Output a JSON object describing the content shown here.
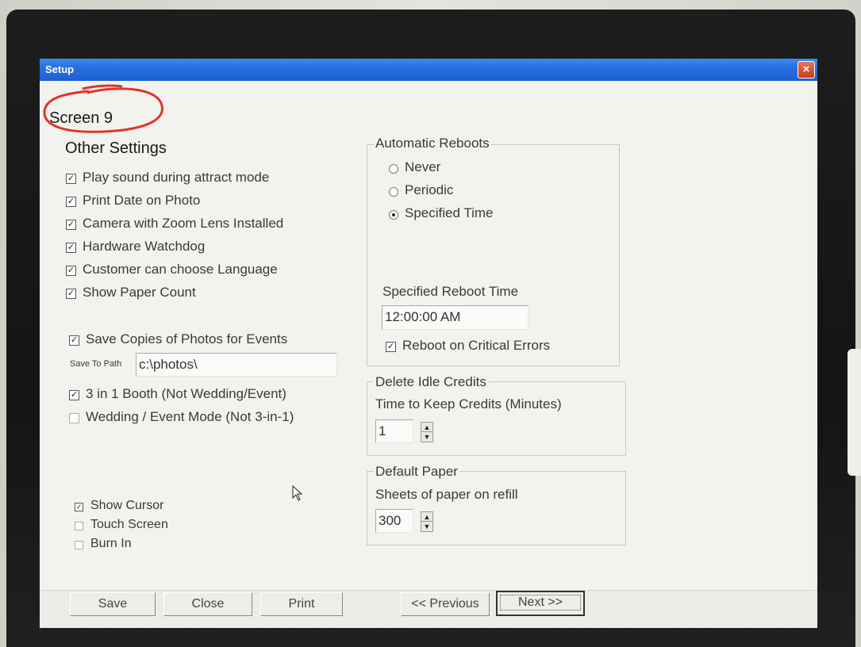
{
  "window": {
    "title": "Setup",
    "close_glyph": "×"
  },
  "screen_label": "Screen 9",
  "section_title": "Other Settings",
  "other_settings": [
    {
      "label": "Play sound during attract mode",
      "checked": true
    },
    {
      "label": "Print Date on Photo",
      "checked": true
    },
    {
      "label": "Camera with Zoom Lens Installed",
      "checked": true
    },
    {
      "label": "Hardware Watchdog",
      "checked": true
    },
    {
      "label": "Customer can choose Language",
      "checked": true
    },
    {
      "label": "Show Paper Count",
      "checked": true
    }
  ],
  "save_copies": {
    "label": "Save Copies of Photos for Events",
    "checked": true
  },
  "save_path": {
    "label": "Save To Path",
    "value": "c:\\photos\\"
  },
  "booth_modes": [
    {
      "label": "3 in 1 Booth (Not Wedding/Event)",
      "checked": true
    },
    {
      "label": "Wedding / Event Mode  (Not 3-in-1)",
      "checked": false
    }
  ],
  "display_options": [
    {
      "label": "Show Cursor",
      "checked": true
    },
    {
      "label": "Touch Screen",
      "checked": false
    },
    {
      "label": "Burn In",
      "checked": false
    }
  ],
  "reboots": {
    "title": "Automatic Reboots",
    "options": [
      {
        "label": "Never",
        "selected": false
      },
      {
        "label": "Periodic",
        "selected": false
      },
      {
        "label": "Specified Time",
        "selected": true
      }
    ],
    "time_label": "Specified Reboot Time",
    "time_value": "12:00:00 AM",
    "critical_label": "Reboot on Critical Errors",
    "critical_checked": true
  },
  "idle_credits": {
    "title": "Delete Idle Credits",
    "label": "Time to Keep Credits (Minutes)",
    "value": "1"
  },
  "paper": {
    "title": "Default Paper",
    "label": "Sheets of paper on refill",
    "value": "300"
  },
  "buttons": {
    "save": "Save",
    "close": "Close",
    "print": "Print",
    "previous": "<< Previous",
    "next": "Next >>"
  },
  "glyphs": {
    "check": "✓",
    "up": "▲",
    "down": "▼"
  },
  "colors": {
    "titlebar": "#2a6fe0",
    "annotation": "#e0342a",
    "close": "#c83a1c"
  }
}
